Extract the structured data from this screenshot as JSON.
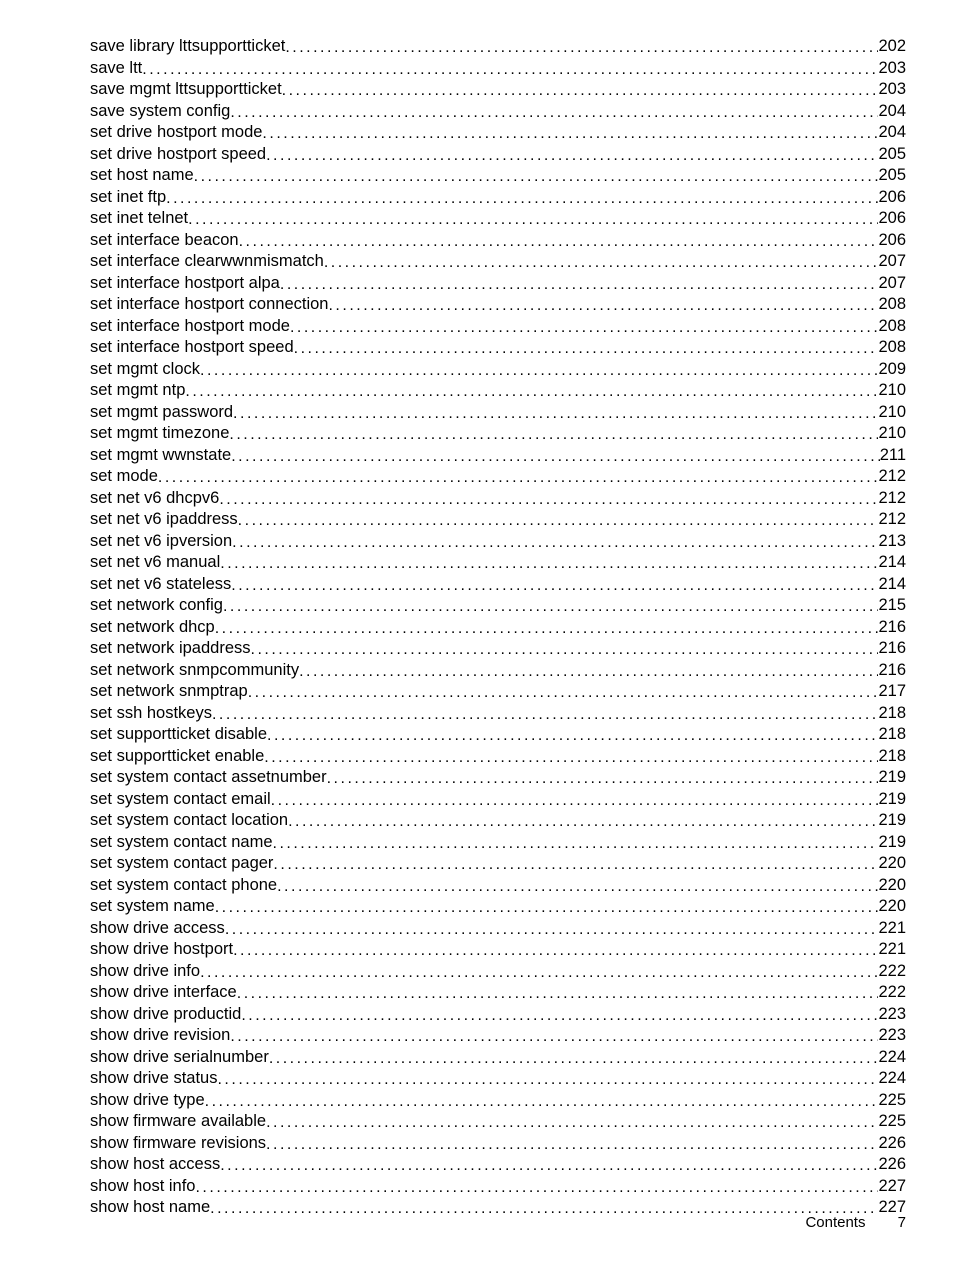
{
  "toc": {
    "entries": [
      {
        "label": "save library lttsupportticket",
        "page": "202"
      },
      {
        "label": "save ltt",
        "page": "203"
      },
      {
        "label": "save mgmt lttsupportticket",
        "page": "203"
      },
      {
        "label": "save system config",
        "page": "204"
      },
      {
        "label": "set drive hostport mode",
        "page": "204"
      },
      {
        "label": "set drive hostport speed",
        "page": "205"
      },
      {
        "label": "set host name",
        "page": "205"
      },
      {
        "label": "set inet ftp",
        "page": "206"
      },
      {
        "label": "set inet telnet",
        "page": "206"
      },
      {
        "label": "set interface beacon",
        "page": "206"
      },
      {
        "label": "set interface clearwwnmismatch",
        "page": "207"
      },
      {
        "label": "set interface hostport alpa",
        "page": "207"
      },
      {
        "label": "set interface hostport connection",
        "page": "208"
      },
      {
        "label": "set interface hostport mode",
        "page": "208"
      },
      {
        "label": "set interface hostport speed",
        "page": "208"
      },
      {
        "label": "set mgmt clock",
        "page": "209"
      },
      {
        "label": "set mgmt ntp",
        "page": "210"
      },
      {
        "label": "set mgmt password",
        "page": "210"
      },
      {
        "label": "set mgmt timezone",
        "page": "210"
      },
      {
        "label": "set mgmt wwnstate",
        "page": "211"
      },
      {
        "label": "set mode",
        "page": "212"
      },
      {
        "label": "set net v6 dhcpv6",
        "page": "212"
      },
      {
        "label": "set net v6 ipaddress",
        "page": "212"
      },
      {
        "label": "set net v6 ipversion",
        "page": "213"
      },
      {
        "label": "set net v6 manual",
        "page": "214"
      },
      {
        "label": "set net v6 stateless",
        "page": "214"
      },
      {
        "label": "set network config ",
        "page": "215"
      },
      {
        "label": "set network dhcp",
        "page": "216"
      },
      {
        "label": "set network ipaddress",
        "page": "216"
      },
      {
        "label": "set network snmpcommunity",
        "page": "216"
      },
      {
        "label": "set network snmptrap",
        "page": "217"
      },
      {
        "label": "set ssh hostkeys",
        "page": "218"
      },
      {
        "label": "set supportticket disable",
        "page": "218"
      },
      {
        "label": "set supportticket enable",
        "page": "218"
      },
      {
        "label": "set system contact assetnumber",
        "page": "219"
      },
      {
        "label": "set system contact email",
        "page": "219"
      },
      {
        "label": "set system contact location",
        "page": "219"
      },
      {
        "label": "set system contact name",
        "page": "219"
      },
      {
        "label": "set system contact pager",
        "page": "220"
      },
      {
        "label": "set system contact phone",
        "page": "220"
      },
      {
        "label": "set system name",
        "page": "220"
      },
      {
        "label": "show drive access",
        "page": "221"
      },
      {
        "label": "show drive hostport",
        "page": "221"
      },
      {
        "label": "show drive info",
        "page": "222"
      },
      {
        "label": "show drive interface",
        "page": "222"
      },
      {
        "label": "show drive productid",
        "page": "223"
      },
      {
        "label": "show drive revision",
        "page": "223"
      },
      {
        "label": "show drive serialnumber",
        "page": "224"
      },
      {
        "label": "show drive status",
        "page": "224"
      },
      {
        "label": "show drive type",
        "page": "225"
      },
      {
        "label": "show firmware available",
        "page": "225"
      },
      {
        "label": "show firmware revisions",
        "page": "226"
      },
      {
        "label": "show host access",
        "page": "226"
      },
      {
        "label": "show host info",
        "page": "227"
      },
      {
        "label": "show host name",
        "page": "227"
      }
    ]
  },
  "footer": {
    "section": "Contents",
    "page_number": "7"
  }
}
